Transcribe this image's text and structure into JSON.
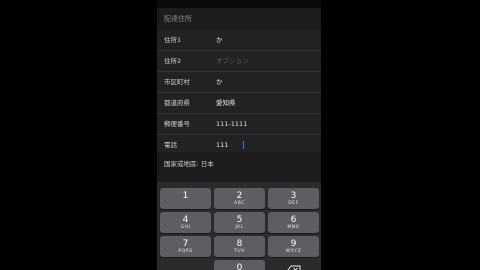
{
  "section_title": "配達住所",
  "fields": [
    {
      "label": "住所1",
      "value": "か",
      "placeholder": false
    },
    {
      "label": "住所2",
      "value": "オプション",
      "placeholder": true
    },
    {
      "label": "市区町村",
      "value": "か",
      "placeholder": false
    },
    {
      "label": "都道府県",
      "value": "愛知県",
      "placeholder": false
    },
    {
      "label": "郵便番号",
      "value": "111-1111",
      "placeholder": false
    },
    {
      "label": "電話",
      "value": "111",
      "placeholder": false
    }
  ],
  "country_row": "国家或地區: 日本",
  "keypad": [
    {
      "num": "1",
      "sub": ""
    },
    {
      "num": "2",
      "sub": "ABC"
    },
    {
      "num": "3",
      "sub": "DEF"
    },
    {
      "num": "4",
      "sub": "GHI"
    },
    {
      "num": "5",
      "sub": "JKL"
    },
    {
      "num": "6",
      "sub": "MNO"
    },
    {
      "num": "7",
      "sub": "PQRS"
    },
    {
      "num": "8",
      "sub": "TUV"
    },
    {
      "num": "9",
      "sub": "WXYZ"
    },
    {
      "num": "0",
      "sub": ""
    }
  ],
  "icons": {
    "delete_key": "backspace-icon"
  }
}
